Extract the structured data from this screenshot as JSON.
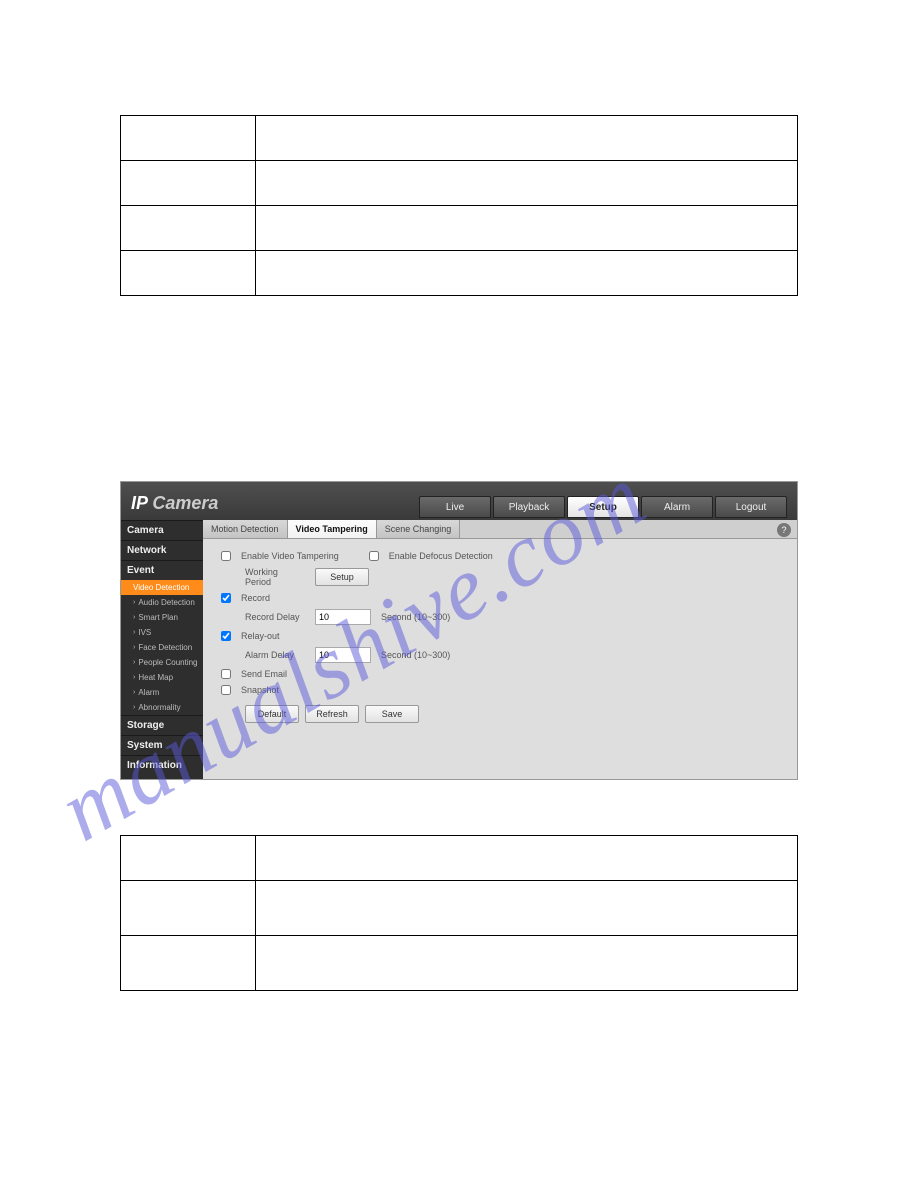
{
  "brand": {
    "prefix": "IP",
    "suffix": " Camera"
  },
  "main_tabs": [
    "Live",
    "Playback",
    "Setup",
    "Alarm",
    "Logout"
  ],
  "main_tab_active": "Setup",
  "sidebar": {
    "camera": "Camera",
    "network": "Network",
    "event": "Event",
    "event_items": [
      "Video Detection",
      "Audio Detection",
      "Smart Plan",
      "IVS",
      "Face Detection",
      "People Counting",
      "Heat Map",
      "Alarm",
      "Abnormality"
    ],
    "event_active": "Video Detection",
    "storage": "Storage",
    "system": "System",
    "information": "Information"
  },
  "sub_tabs": [
    "Motion Detection",
    "Video Tampering",
    "Scene Changing"
  ],
  "sub_tab_active": "Video Tampering",
  "form": {
    "enable_vt": "Enable Video Tampering",
    "enable_dd": "Enable Defocus Detection",
    "working_period": "Working Period",
    "setup_btn": "Setup",
    "record": "Record",
    "record_delay": "Record Delay",
    "record_delay_val": "10",
    "seconds_hint": "Second (10~300)",
    "relay_out": "Relay-out",
    "alarm_delay": "Alarm Delay",
    "alarm_delay_val": "10",
    "send_email": "Send Email",
    "snapshot": "Snapshot",
    "default_btn": "Default",
    "refresh_btn": "Refresh",
    "save_btn": "Save"
  },
  "help_icon": "?",
  "watermark": "manualshive.com"
}
